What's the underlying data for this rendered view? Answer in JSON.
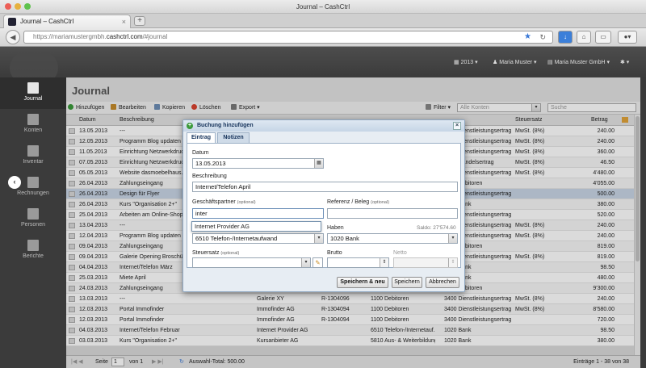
{
  "window": {
    "title": "Journal – CashCtrl",
    "tab_label": "Journal – CashCtrl",
    "url_prefix": "https://mariamustergmbh.",
    "url_domain": "cashctrl.com",
    "url_suffix": "/#journal"
  },
  "colors": {
    "accent": "#3a78d6",
    "selected_row": "#c9d6e6",
    "sidebar": "#3b3b3b",
    "dialog_header": "#c5d5e6"
  },
  "topnav": {
    "year": "2013",
    "user": "Maria Muster",
    "company": "Maria Muster GmbH"
  },
  "sidebar": {
    "items": [
      {
        "label": "Journal",
        "icon": "book-icon"
      },
      {
        "label": "Konten",
        "icon": "bank-icon"
      },
      {
        "label": "Inventar",
        "icon": "inventory-icon"
      },
      {
        "label": "Rechnungen",
        "icon": "invoice-icon"
      },
      {
        "label": "Personen",
        "icon": "person-icon"
      },
      {
        "label": "Berichte",
        "icon": "chart-icon"
      }
    ]
  },
  "main": {
    "title": "Journal"
  },
  "toolbar": {
    "add": "Hinzufügen",
    "edit": "Bearbeiten",
    "copy": "Kopieren",
    "delete": "Löschen",
    "export": "Export",
    "filter": "Filter",
    "filter_placeholder": "Alle Konten",
    "search_placeholder": "Suche"
  },
  "grid": {
    "headers": {
      "datum": "Datum",
      "beschreibung": "Beschreibung",
      "steuersatz": "Steuersatz",
      "betrag": "Betrag"
    },
    "rows": [
      {
        "date": "13.05.2013",
        "desc": "---",
        "person": "",
        "ref": "",
        "soll": "",
        "haben": "3400 Dienstleistungsertrag",
        "tax": "MwSt. (8%)",
        "amount": "240.00"
      },
      {
        "date": "12.05.2013",
        "desc": "Programm Blog updaten",
        "person": "",
        "ref": "",
        "soll": "",
        "haben": "3400 Dienstleistungsertrag",
        "tax": "MwSt. (8%)",
        "amount": "240.00"
      },
      {
        "date": "11.05.2013",
        "desc": "Einrichtung Netzwerkdrucker",
        "person": "",
        "ref": "",
        "soll": "",
        "haben": "3400 Dienstleistungsertrag",
        "tax": "MwSt. (8%)",
        "amount": "360.00"
      },
      {
        "date": "07.05.2013",
        "desc": "Einrichtung Netzwerkdrucker",
        "person": "",
        "ref": "",
        "soll": "",
        "haben": "3200 Handelsertrag",
        "tax": "MwSt. (8%)",
        "amount": "46.50"
      },
      {
        "date": "05.05.2013",
        "desc": "Website dasmoebelhaus.ch",
        "person": "",
        "ref": "",
        "soll": "",
        "haben": "3400 Dienstleistungsertrag",
        "tax": "MwSt. (8%)",
        "amount": "4'480.00"
      },
      {
        "date": "26.04.2013",
        "desc": "Zahlungseingang",
        "person": "",
        "ref": "",
        "soll": "",
        "haben": "1100 Debitoren",
        "tax": "",
        "amount": "4'055.00"
      },
      {
        "date": "26.04.2013",
        "desc": "Design für Flyer",
        "person": "",
        "ref": "",
        "soll": "",
        "haben": "3400 Dienstleistungsertrag",
        "tax": "",
        "amount": "500.00"
      },
      {
        "date": "26.04.2013",
        "desc": "Kurs \"Organisation 2+\"",
        "person": "",
        "ref": "",
        "soll": "",
        "haben": "1020 Bank",
        "tax": "",
        "amount": "380.00"
      },
      {
        "date": "25.04.2013",
        "desc": "Arbeiten am Online-Shop",
        "person": "",
        "ref": "",
        "soll": "",
        "haben": "3400 Dienstleistungsertrag",
        "tax": "",
        "amount": "520.00"
      },
      {
        "date": "13.04.2013",
        "desc": "---",
        "person": "",
        "ref": "",
        "soll": "",
        "haben": "3400 Dienstleistungsertrag",
        "tax": "MwSt. (8%)",
        "amount": "240.00"
      },
      {
        "date": "12.04.2013",
        "desc": "Programm Blog updaten",
        "person": "",
        "ref": "",
        "soll": "",
        "haben": "3400 Dienstleistungsertrag",
        "tax": "MwSt. (8%)",
        "amount": "240.00"
      },
      {
        "date": "09.04.2013",
        "desc": "Zahlungseingang",
        "person": "",
        "ref": "",
        "soll": "",
        "haben": "1100 Debitoren",
        "tax": "",
        "amount": "819.00"
      },
      {
        "date": "09.04.2013",
        "desc": "Galerie Opening Broschüre",
        "person": "",
        "ref": "",
        "soll": "",
        "haben": "3400 Dienstleistungsertrag",
        "tax": "MwSt. (8%)",
        "amount": "819.00"
      },
      {
        "date": "04.04.2013",
        "desc": "Internet/Telefon März",
        "person": "",
        "ref": "",
        "soll": "",
        "haben": "1020 Bank",
        "tax": "",
        "amount": "98.50"
      },
      {
        "date": "25.03.2013",
        "desc": "Miete April",
        "person": "",
        "ref": "",
        "soll": "",
        "haben": "1020 Bank",
        "tax": "",
        "amount": "480.00"
      },
      {
        "date": "24.03.2013",
        "desc": "Zahlungseingang",
        "person": "",
        "ref": "",
        "soll": "",
        "haben": "1100 Debitoren",
        "tax": "",
        "amount": "9'300.00"
      },
      {
        "date": "13.03.2013",
        "desc": "---",
        "person": "Galerie XY",
        "ref": "R-1304096",
        "soll": "1100 Debitoren",
        "haben": "3400 Dienstleistungsertrag",
        "tax": "MwSt. (8%)",
        "amount": "240.00"
      },
      {
        "date": "12.03.2013",
        "desc": "Portal Immofinder",
        "person": "Immofinder AG",
        "ref": "R-1304094",
        "soll": "1100 Debitoren",
        "haben": "3400 Dienstleistungsertrag",
        "tax": "MwSt. (8%)",
        "amount": "8'580.00"
      },
      {
        "date": "12.03.2013",
        "desc": "Portal Immofinder",
        "person": "Immofinder AG",
        "ref": "R-1304094",
        "soll": "1100 Debitoren",
        "haben": "3400 Dienstleistungsertrag",
        "tax": "",
        "amount": "720.00"
      },
      {
        "date": "04.03.2013",
        "desc": "Internet/Telefon Februar",
        "person": "Internet Provider AG",
        "ref": "",
        "soll": "6510 Telefon-/Internetauf...",
        "haben": "1020 Bank",
        "tax": "",
        "amount": "98.50"
      },
      {
        "date": "03.03.2013",
        "desc": "Kurs \"Organisation 2+\"",
        "person": "Kursanbieter AG",
        "ref": "",
        "soll": "5810 Aus- & Weiterbildung",
        "haben": "1020 Bank",
        "tax": "",
        "amount": "380.00"
      }
    ]
  },
  "pager": {
    "page_label": "Seite",
    "page_value": "1",
    "of_label": "von 1",
    "total": "Auswahl-Total: 500.00",
    "range": "Einträge 1 - 38 von 38"
  },
  "dialog": {
    "title": "Buchung hinzufügen",
    "tabs": [
      "Eintrag",
      "Notizen"
    ],
    "datum_label": "Datum",
    "datum_value": "13.05.2013",
    "beschreibung_label": "Beschreibung",
    "beschreibung_value": "Internet/Telefon April",
    "partner_label": "Geschäftspartner",
    "optional": "(optional)",
    "partner_value": "inter",
    "ref_label": "Referenz / Beleg",
    "autocomplete": "Internet Provider AG",
    "haben_label": "Haben",
    "saldo": "Saldo: 27'574.60",
    "soll_value": "6510 Telefon-/Internetaufwand",
    "haben_value": "1020 Bank",
    "steuersatz_label": "Steuersatz",
    "brutto_label": "Brutto",
    "netto_label": "Netto",
    "btn_save_new": "Speichern & neu",
    "btn_save": "Speichern",
    "btn_cancel": "Abbrechen"
  }
}
